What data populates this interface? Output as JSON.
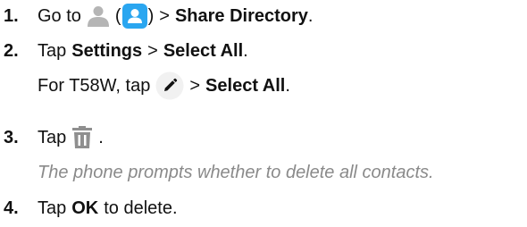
{
  "steps": [
    {
      "number": "1.",
      "text_go_to": "Go to",
      "paren_open": "(",
      "paren_close": ")",
      "sep": ">",
      "share_directory": "Share Directory",
      "period": "."
    },
    {
      "number": "2.",
      "tap": "Tap",
      "settings": "Settings",
      "sep": ">",
      "select_all": "Select All",
      "period": ".",
      "t58w_prefix": "For T58W, tap",
      "t58w_sep": ">",
      "t58w_select_all": "Select All",
      "t58w_period": "."
    },
    {
      "number": "3.",
      "tap": "Tap",
      "period": ".",
      "note": "The phone prompts whether to delete all contacts."
    },
    {
      "number": "4.",
      "tap": "Tap",
      "ok": "OK",
      "rest": "to delete."
    }
  ],
  "icons": {
    "person": "person-icon",
    "contact_app": "contact-app-icon",
    "edit": "edit-pencil-icon",
    "trash": "trash-icon"
  },
  "colors": {
    "text": "#111111",
    "note": "#8a8a8a",
    "accent_blue": "#2aa6f0",
    "icon_gray": "#b5b5b5"
  }
}
